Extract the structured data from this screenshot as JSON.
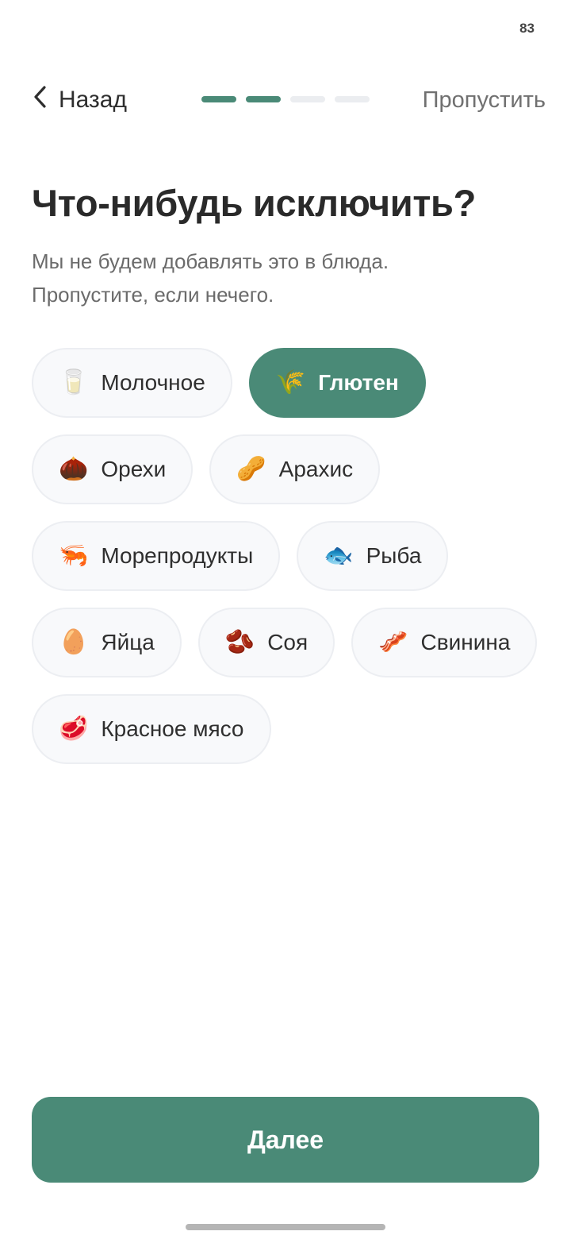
{
  "status": {
    "battery": "83"
  },
  "header": {
    "back_label": "Назад",
    "skip_label": "Пропустить",
    "progress": {
      "current_step": 2,
      "total_steps": 4
    }
  },
  "main": {
    "title": "Что-нибудь исключить?",
    "subtitle_lines": [
      "Мы не будем добавлять это в блюда.",
      "Пропустите, если нечего."
    ],
    "chips": [
      {
        "label": "Молочное",
        "emoji": "🥛",
        "selected": false
      },
      {
        "label": "Глютен",
        "emoji": "🌾",
        "selected": true
      },
      {
        "label": "Орехи",
        "emoji": "🌰",
        "selected": false
      },
      {
        "label": "Арахис",
        "emoji": "🥜",
        "selected": false
      },
      {
        "label": "Морепродукты",
        "emoji": "🦐",
        "selected": false
      },
      {
        "label": "Рыба",
        "emoji": "🐟",
        "selected": false
      },
      {
        "label": "Яйца",
        "emoji": "🥚",
        "selected": false
      },
      {
        "label": "Соя",
        "emoji": "🫘",
        "selected": false
      },
      {
        "label": "Свинина",
        "emoji": "🥓",
        "selected": false
      },
      {
        "label": "Красное мясо",
        "emoji": "🥩",
        "selected": false
      }
    ]
  },
  "footer": {
    "next_label": "Далее"
  },
  "colors": {
    "accent": "#4a8a77",
    "chip_bg": "#f8f9fb",
    "progress_inactive": "#ebedf0"
  }
}
